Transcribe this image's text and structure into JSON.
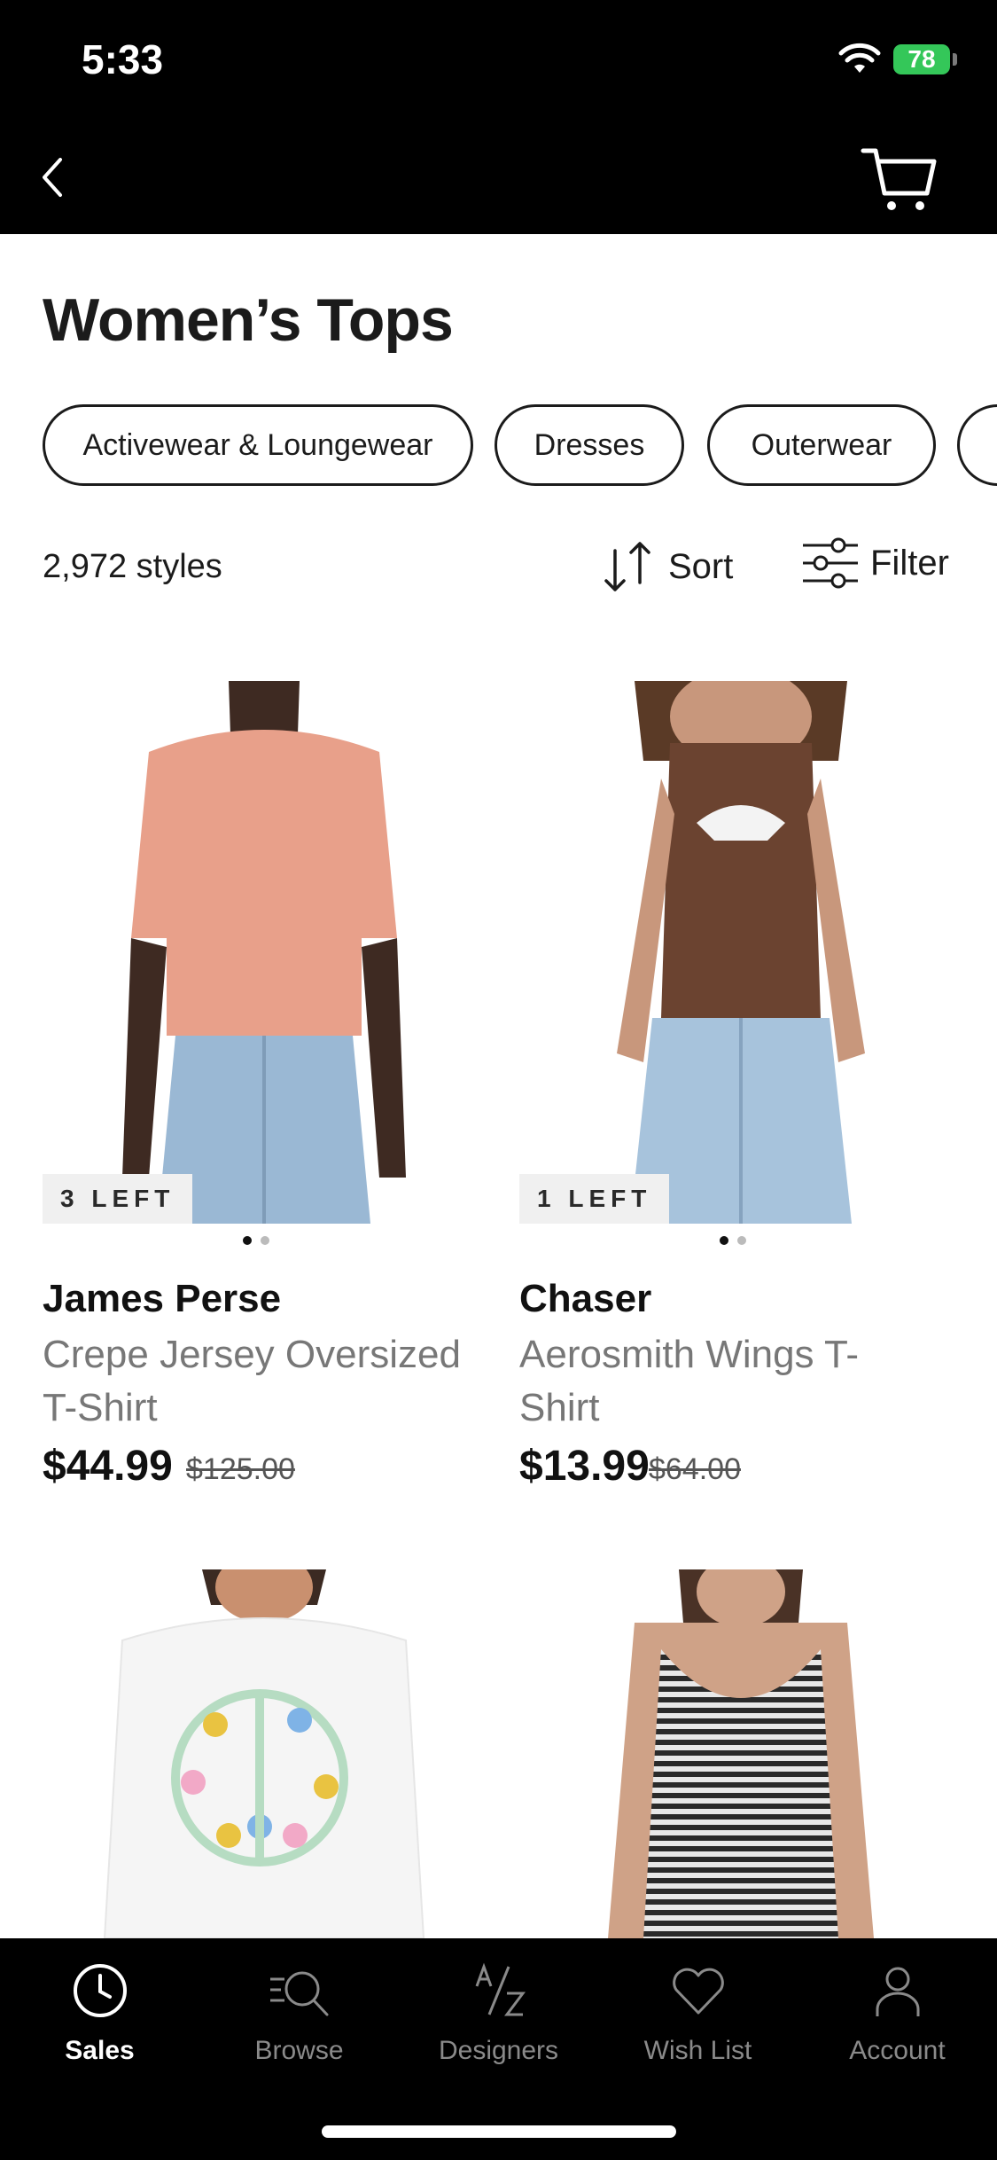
{
  "status": {
    "time": "5:33",
    "battery": "78"
  },
  "page": {
    "title": "Women’s Tops"
  },
  "chips": [
    "Activewear & Loungewear",
    "Dresses",
    "Outerwear",
    ""
  ],
  "toolbar": {
    "count": "2,972 styles",
    "sort_label": "Sort",
    "filter_label": "Filter"
  },
  "products": [
    {
      "badge": "3 LEFT",
      "brand": "James Perse",
      "name_line1": "Crepe Jersey Oversized",
      "name_line2": "T-Shirt",
      "price": "$44.99",
      "original_price": "$125.00",
      "image_colors": {
        "shirt": "#e8a08a",
        "skin": "#3e2a22",
        "jeans": "#9ab8d4"
      }
    },
    {
      "badge": "1 LEFT",
      "brand": "Chaser",
      "name_line1": "Aerosmith Wings T-",
      "name_line2": "Shirt",
      "price": "$13.99",
      "original_price": "$64.00",
      "image_colors": {
        "shirt": "#6b4330",
        "skin": "#c8977c",
        "jeans": "#a7c3dc"
      }
    },
    {
      "badge": "",
      "brand": "",
      "name_line1": "",
      "name_line2": "",
      "price": "",
      "original_price": "",
      "image_colors": {
        "shirt": "#f5f5f5",
        "skin": "#c9906f"
      }
    },
    {
      "badge": "",
      "brand": "",
      "name_line1": "",
      "name_line2": "",
      "price": "",
      "original_price": "",
      "image_colors": {
        "shirt": "#7d7d7d",
        "skin": "#cfa287"
      }
    }
  ],
  "tabs": [
    {
      "label": "Sales",
      "icon": "clock-icon",
      "active": true
    },
    {
      "label": "Browse",
      "icon": "search-icon",
      "active": false
    },
    {
      "label": "Designers",
      "icon": "az-icon",
      "active": false
    },
    {
      "label": "Wish List",
      "icon": "heart-icon",
      "active": false
    },
    {
      "label": "Account",
      "icon": "person-icon",
      "active": false
    }
  ],
  "colors": {
    "accent_black": "#000000",
    "battery_green": "#34c759",
    "muted_text": "#777777"
  }
}
